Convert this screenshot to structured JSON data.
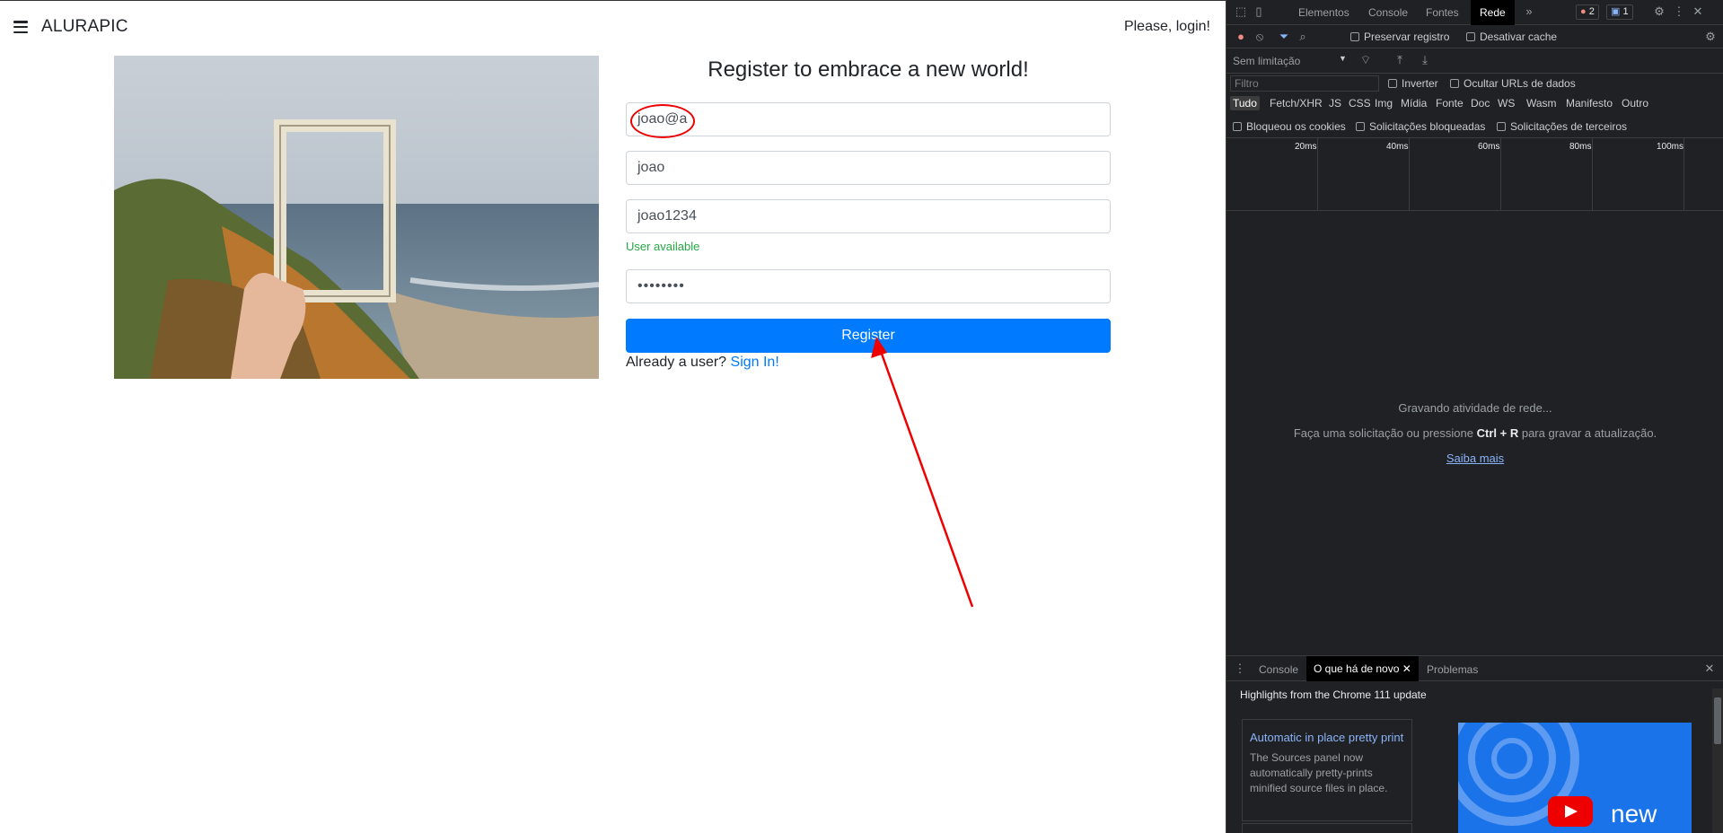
{
  "app": {
    "brand": "ALURAPIC",
    "login_link": "Please, login!"
  },
  "register": {
    "title": "Register to embrace a new world!",
    "email_value": "joao@a",
    "fullname_value": "joao",
    "username_value": "joao1234",
    "user_status": "User available",
    "password_value": "••••••••",
    "register_button": "Register",
    "already_text": "Already a user?",
    "signin_link": "Sign In!"
  },
  "devtools": {
    "tabs": [
      "Elementos",
      "Console",
      "Fontes",
      "Rede"
    ],
    "active_tab": "Rede",
    "error_count": "2",
    "message_count": "1",
    "preserve_log": "Preservar registro",
    "disable_cache": "Desativar cache",
    "throttling": "Sem limitação",
    "filter_placeholder": "Filtro",
    "invert": "Inverter",
    "hide_data_urls": "Ocultar URLs de dados",
    "types": [
      "Tudo",
      "Fetch/XHR",
      "JS",
      "CSS",
      "Img",
      "Mídia",
      "Fonte",
      "Doc",
      "WS",
      "Wasm",
      "Manifesto",
      "Outro"
    ],
    "blocked_cookies": "Bloqueou os cookies",
    "blocked_requests": "Solicitações bloqueadas",
    "third_party": "Solicitações de terceiros",
    "timeline_ticks": [
      "20ms",
      "40ms",
      "60ms",
      "80ms",
      "100ms"
    ],
    "recording": "Gravando atividade de rede...",
    "hint_prefix": "Faça uma solicitação ou pressione",
    "hint_shortcut": "Ctrl + R",
    "hint_suffix": "para gravar a atualização.",
    "learn_more": "Saiba mais",
    "drawer_tabs": [
      "Console",
      "O que há de novo",
      "Problemas"
    ],
    "drawer_active": "O que há de novo",
    "highlights": "Highlights from the Chrome 111 update",
    "card_title": "Automatic in place pretty print",
    "card_body": "The Sources panel now automatically pretty-prints minified source files in place.",
    "video_text": "new"
  },
  "colors": {
    "primary": "#007bff",
    "success": "#28a745",
    "annotation": "#e00000",
    "devtools_bg": "#202124"
  }
}
